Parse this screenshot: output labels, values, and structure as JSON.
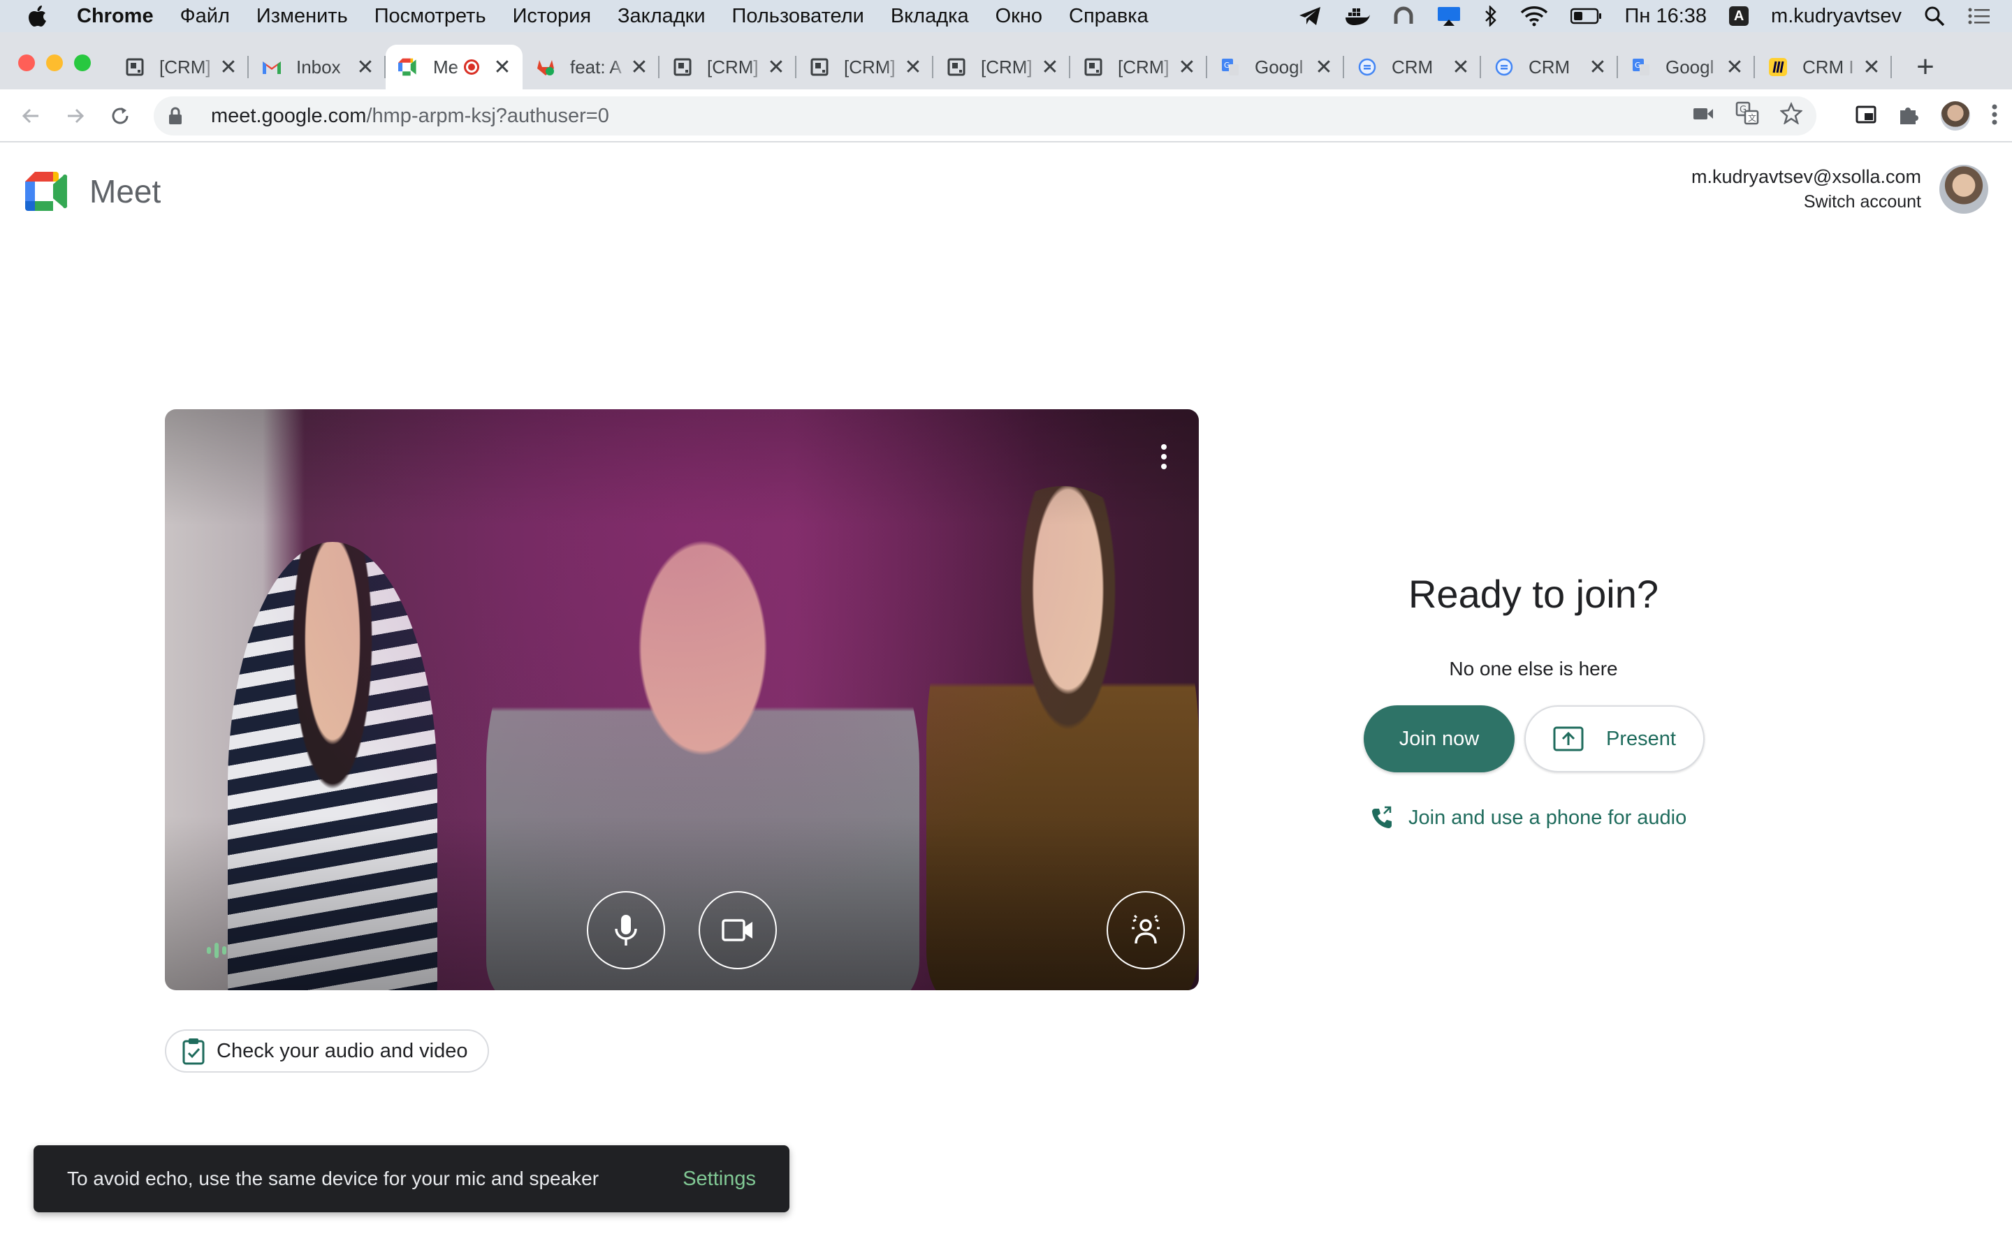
{
  "menubar": {
    "app": "Chrome",
    "items": [
      "Файл",
      "Изменить",
      "Посмотреть",
      "История",
      "Закладки",
      "Пользователи",
      "Вкладка",
      "Окно",
      "Справка"
    ],
    "clock": "Пн 16:38",
    "input_badge": "A",
    "user": "m.kudryavtsev"
  },
  "tabs": [
    {
      "title": "[CRM]",
      "icon": "document-icon"
    },
    {
      "title": "Inbox",
      "icon": "gmail-icon"
    },
    {
      "title": "Me",
      "icon": "meet-icon",
      "active": true,
      "recording": true
    },
    {
      "title": "feat: A",
      "icon": "gitlab-icon"
    },
    {
      "title": "[CRM]",
      "icon": "document-icon"
    },
    {
      "title": "[CRM]",
      "icon": "document-icon"
    },
    {
      "title": "[CRM]",
      "icon": "document-icon"
    },
    {
      "title": "[CRM]",
      "icon": "document-icon"
    },
    {
      "title": "Googl",
      "icon": "google-translate-icon"
    },
    {
      "title": "CRM",
      "icon": "crm-icon"
    },
    {
      "title": "CRM",
      "icon": "crm-icon"
    },
    {
      "title": "Googl",
      "icon": "google-translate-icon"
    },
    {
      "title": "CRM I",
      "icon": "miro-icon"
    }
  ],
  "address": {
    "host": "meet.google.com",
    "path": "/hmp-arpm-ksj?authuser=0"
  },
  "meet": {
    "logo_text": "Meet",
    "account_email": "m.kudryavtsev@xsolla.com",
    "switch_account": "Switch account",
    "ready_title": "Ready to join?",
    "status": "No one else is here",
    "join_label": "Join now",
    "present_label": "Present",
    "phone_label": "Join and use a phone for audio",
    "check_label": "Check your audio and video"
  },
  "snackbar": {
    "message": "To avoid echo, use the same device for your mic and speaker",
    "action": "Settings"
  },
  "colors": {
    "accent": "#2e7367",
    "accent_text": "#1e6b5c",
    "snackbar_bg": "#202124",
    "snackbar_action": "#81c995"
  }
}
